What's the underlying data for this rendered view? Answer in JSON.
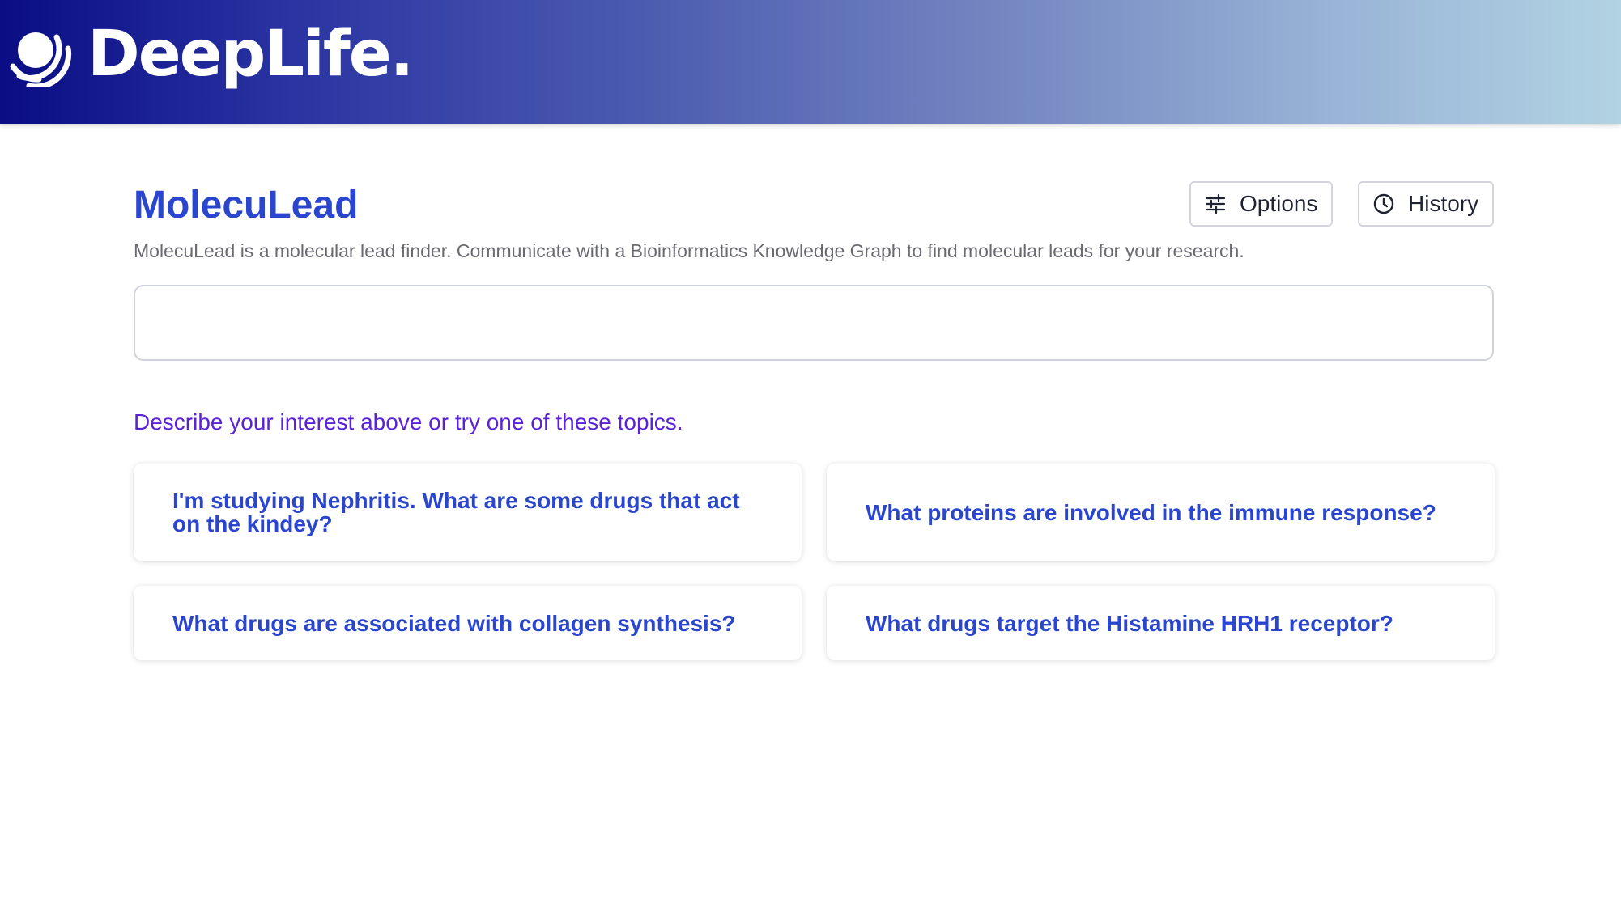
{
  "header": {
    "brand_name": "DeepLife.",
    "logo_icon": "deeplife-logo-icon",
    "gradient_colors": [
      "#0a0d84",
      "#b2d3e3"
    ]
  },
  "app": {
    "title": "MolecuLead",
    "description": "MolecuLead is a molecular lead finder. Communicate with a Bioinformatics Knowledge Graph to find molecular leads for your research.",
    "accent_color": "#2a46cf"
  },
  "toolbar": {
    "options_label": "Options",
    "options_icon": "sliders-icon",
    "history_label": "History",
    "history_icon": "clock-icon"
  },
  "query": {
    "value": "",
    "placeholder": ""
  },
  "topics": {
    "hint": "Describe your interest above or try one of these topics.",
    "hint_color": "#5b22d6",
    "items": [
      "I'm studying Nephritis. What are some drugs that act on the kindey?",
      "What proteins are involved in the immune response?",
      "What drugs are associated with collagen synthesis?",
      "What drugs target the Histamine HRH1 receptor?"
    ]
  }
}
